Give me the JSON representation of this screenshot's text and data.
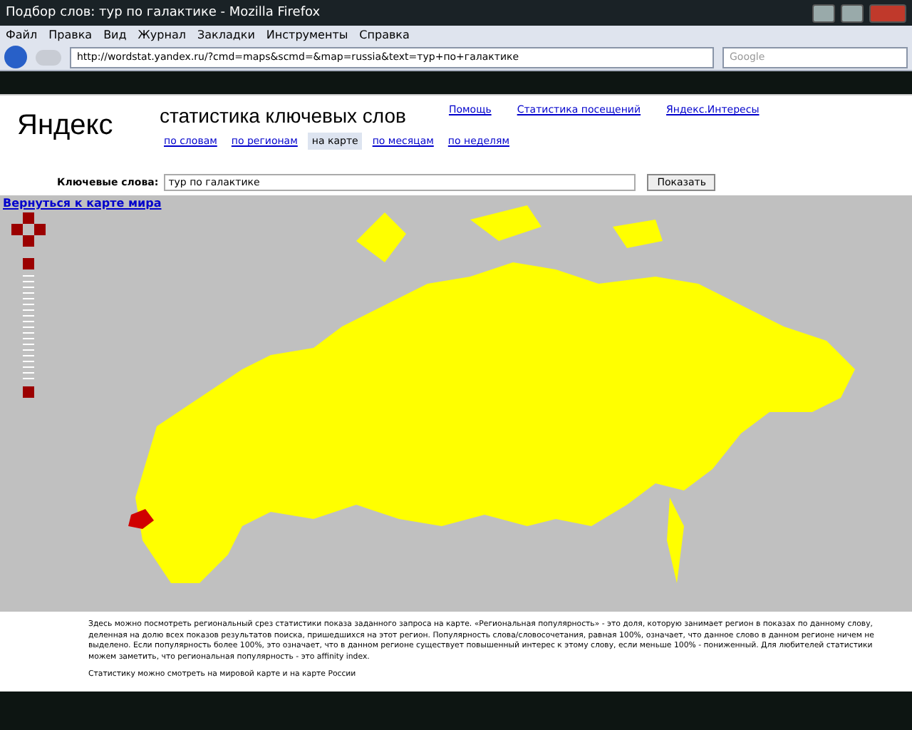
{
  "window": {
    "title": "Подбор слов: тур по галактике - Mozilla Firefox"
  },
  "menu": [
    "Файл",
    "Правка",
    "Вид",
    "Журнал",
    "Закладки",
    "Инструменты",
    "Справка"
  ],
  "address": {
    "value": "http://wordstat.yandex.ru/?cmd=maps&scmd=&map=russia&text=тур+по+галактике"
  },
  "search": {
    "placeholder": "Google"
  },
  "page": {
    "logo": "Яндекс",
    "heading": "статистика ключевых слов",
    "top_links": [
      "Помощь",
      "Статистика посещений",
      "Яндекс.Интересы"
    ],
    "tabs": [
      {
        "label": "по словам",
        "selected": false
      },
      {
        "label": "по регионам",
        "selected": false
      },
      {
        "label": "на карте",
        "selected": true
      },
      {
        "label": "по месяцам",
        "selected": false
      },
      {
        "label": "по неделям",
        "selected": false
      }
    ],
    "keyword_label": "Ключевые слова:",
    "keyword_value": "тур по галактике",
    "submit": "Показать"
  },
  "map": {
    "back_link": "Вернуться к карте мира"
  },
  "description": [
    "Здесь можно посмотреть региональный срез статистики показа заданного запроса на карте. «Региональная популярность» - это доля, которую занимает регион в показах по данному слову, деленная на долю всех показов результатов поиска, пришедшихся на этот регион. Популярность слова/словосочетания, равная 100%, означает, что данное слово в данном регионе ничем не выделено. Если популярность более 100%, это означает, что в данном регионе существует повышенный интерес к этому слову, если меньше 100% - пониженный. Для любителей статистики можем заметить, что региональная популярность - это affinity index.",
    "Статистику можно смотреть на мировой карте и на карте России"
  ]
}
